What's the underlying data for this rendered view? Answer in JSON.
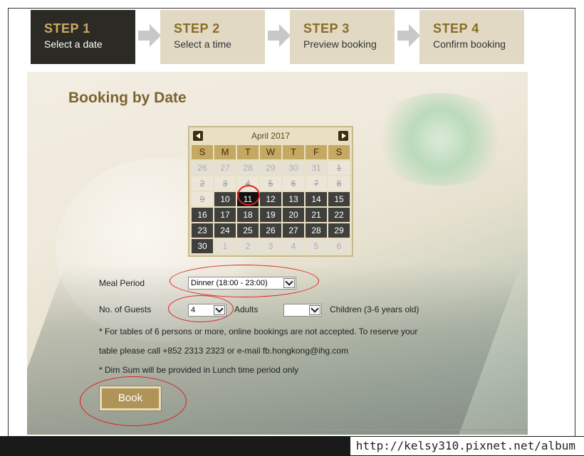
{
  "steps": [
    {
      "title": "STEP 1",
      "subtitle": "Select a date"
    },
    {
      "title": "STEP 2",
      "subtitle": "Select a time"
    },
    {
      "title": "STEP 3",
      "subtitle": "Preview booking"
    },
    {
      "title": "STEP 4",
      "subtitle": "Confirm booking"
    }
  ],
  "active_step": 1,
  "page_title": "Booking by Date",
  "calendar": {
    "month_label": "April 2017",
    "weekdays": [
      "S",
      "M",
      "T",
      "W",
      "T",
      "F",
      "S"
    ],
    "selected_day": "11",
    "weeks": [
      [
        {
          "d": "26",
          "s": "other"
        },
        {
          "d": "27",
          "s": "other"
        },
        {
          "d": "28",
          "s": "other"
        },
        {
          "d": "29",
          "s": "other"
        },
        {
          "d": "30",
          "s": "other"
        },
        {
          "d": "31",
          "s": "other"
        },
        {
          "d": "1",
          "s": "off"
        }
      ],
      [
        {
          "d": "2",
          "s": "off"
        },
        {
          "d": "3",
          "s": "off"
        },
        {
          "d": "4",
          "s": "off"
        },
        {
          "d": "5",
          "s": "off"
        },
        {
          "d": "6",
          "s": "off"
        },
        {
          "d": "7",
          "s": "off"
        },
        {
          "d": "8",
          "s": "off"
        }
      ],
      [
        {
          "d": "9",
          "s": "off"
        },
        {
          "d": "10",
          "s": "avail"
        },
        {
          "d": "11",
          "s": "selected"
        },
        {
          "d": "12",
          "s": "avail"
        },
        {
          "d": "13",
          "s": "avail"
        },
        {
          "d": "14",
          "s": "avail"
        },
        {
          "d": "15",
          "s": "avail"
        }
      ],
      [
        {
          "d": "16",
          "s": "avail"
        },
        {
          "d": "17",
          "s": "avail"
        },
        {
          "d": "18",
          "s": "avail"
        },
        {
          "d": "19",
          "s": "avail"
        },
        {
          "d": "20",
          "s": "avail"
        },
        {
          "d": "21",
          "s": "avail"
        },
        {
          "d": "22",
          "s": "avail"
        }
      ],
      [
        {
          "d": "23",
          "s": "avail"
        },
        {
          "d": "24",
          "s": "avail"
        },
        {
          "d": "25",
          "s": "avail"
        },
        {
          "d": "26",
          "s": "avail"
        },
        {
          "d": "27",
          "s": "avail"
        },
        {
          "d": "28",
          "s": "avail"
        },
        {
          "d": "29",
          "s": "avail"
        }
      ],
      [
        {
          "d": "30",
          "s": "avail"
        },
        {
          "d": "1",
          "s": "other"
        },
        {
          "d": "2",
          "s": "other"
        },
        {
          "d": "3",
          "s": "other"
        },
        {
          "d": "4",
          "s": "other"
        },
        {
          "d": "5",
          "s": "other"
        },
        {
          "d": "6",
          "s": "other"
        }
      ]
    ]
  },
  "form": {
    "meal_period_label": "Meal Period",
    "meal_period_value": "Dinner (18:00 - 23:00)",
    "guests_label": "No. of Guests",
    "adults_value": "4",
    "adults_label": "Adults",
    "children_value": "",
    "children_label": "Children (3-6 years old)"
  },
  "notes": {
    "line1": "* For tables of 6 persons or more, online bookings are not accepted. To reserve your",
    "line2": "table please call +852 2313 2323 or e-mail fb.hongkong@ihg.com",
    "line3": "* Dim Sum will be provided in Lunch time period only"
  },
  "book_button": "Book",
  "watermark": "http://kelsy310.pixnet.net/album",
  "colors": {
    "accent_gold": "#c5a962",
    "active_step_bg": "#2b2a25",
    "annotation_red": "#dd2222"
  }
}
